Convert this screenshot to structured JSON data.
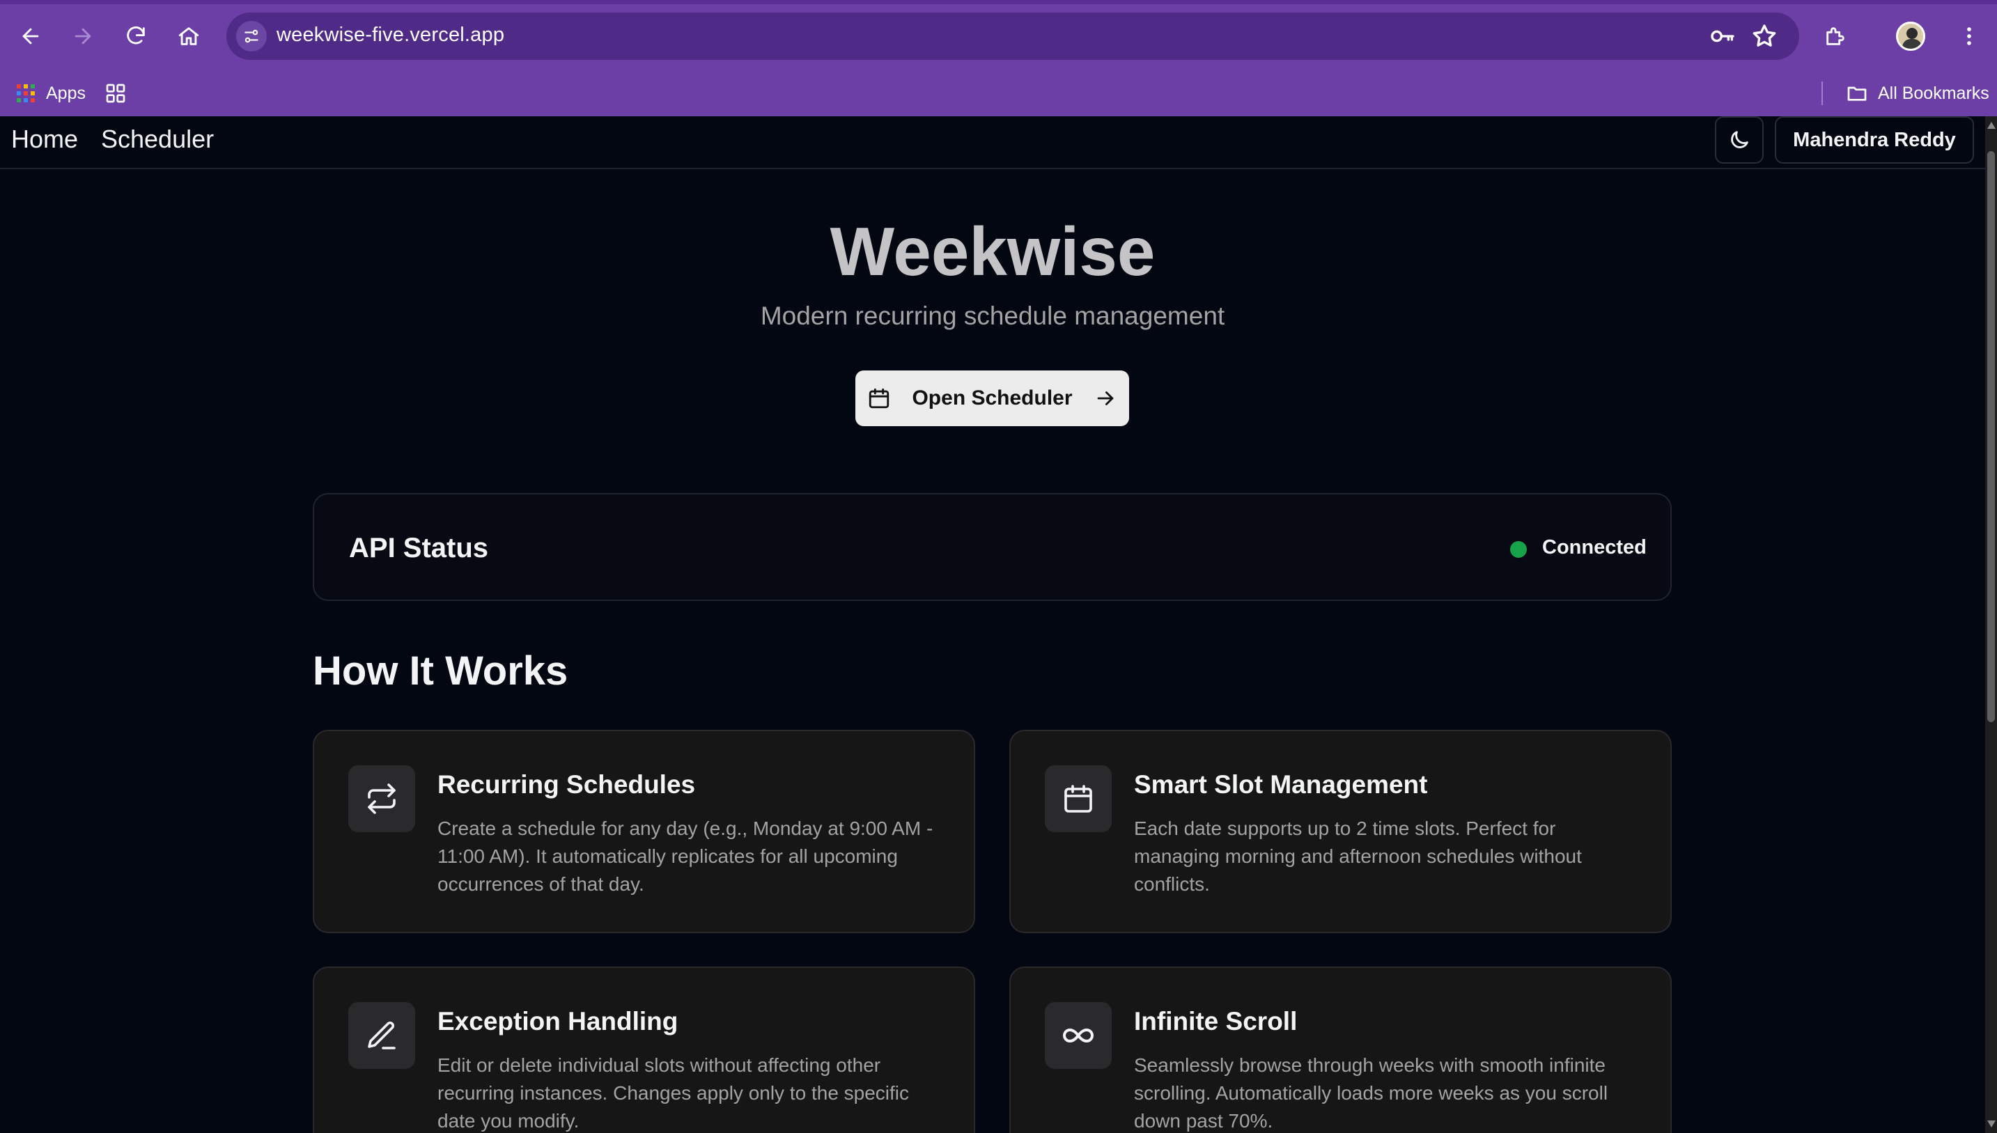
{
  "browser": {
    "url": "weekwise-five.vercel.app",
    "bookmarks": {
      "apps_label": "Apps",
      "all_bookmarks_label": "All Bookmarks"
    }
  },
  "nav": {
    "home_label": "Home",
    "scheduler_label": "Scheduler",
    "user_label": "Mahendra Reddy"
  },
  "hero": {
    "title": "Weekwise",
    "subtitle": "Modern recurring schedule management",
    "cta_label": "Open Scheduler"
  },
  "api_status": {
    "title": "API Status",
    "status": "Connected",
    "status_color": "#16a34a"
  },
  "how_it_works": {
    "title": "How It Works",
    "cards": [
      {
        "icon": "repeat-icon",
        "title": "Recurring Schedules",
        "description": "Create a schedule for any day (e.g., Monday at 9:00 AM - 11:00 AM). It automatically replicates for all upcoming occurrences of that day."
      },
      {
        "icon": "calendar-icon",
        "title": "Smart Slot Management",
        "description": "Each date supports up to 2 time slots. Perfect for managing morning and afternoon schedules without conflicts."
      },
      {
        "icon": "pencil-icon",
        "title": "Exception Handling",
        "description": "Edit or delete individual slots without affecting other recurring instances. Changes apply only to the specific date you modify."
      },
      {
        "icon": "infinity-icon",
        "title": "Infinite Scroll",
        "description": "Seamlessly browse through weeks with smooth infinite scrolling. Automatically loads more weeks as you scroll down past 70%."
      }
    ]
  },
  "colors": {
    "browser_frame": "#6b3fa6",
    "page_background": "#030712",
    "card_background": "#161616"
  }
}
